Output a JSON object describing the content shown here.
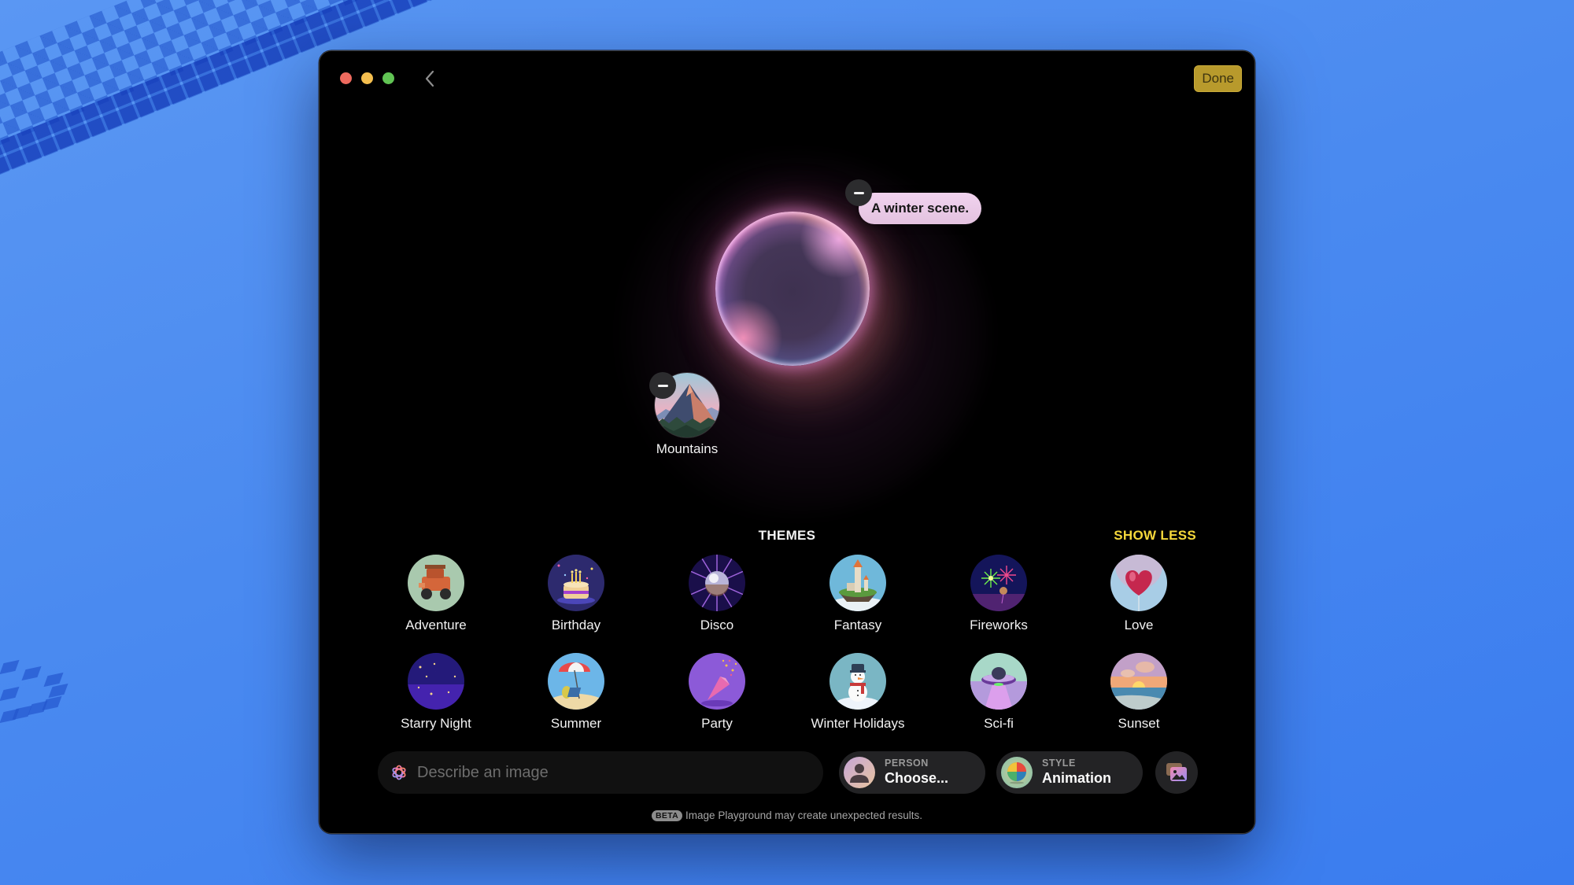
{
  "window": {
    "back_label": "Back",
    "done_label": "Done"
  },
  "canvas": {
    "prompt_chip": "A winter scene.",
    "concepts": [
      {
        "label": "Mountains",
        "icon": "mountain-icon"
      }
    ]
  },
  "themes": {
    "title": "THEMES",
    "toggle_label": "SHOW LESS",
    "items": [
      {
        "label": "Adventure",
        "icon": "jeep-icon"
      },
      {
        "label": "Birthday",
        "icon": "cake-icon"
      },
      {
        "label": "Disco",
        "icon": "disco-ball-icon"
      },
      {
        "label": "Fantasy",
        "icon": "castle-icon"
      },
      {
        "label": "Fireworks",
        "icon": "fireworks-icon"
      },
      {
        "label": "Love",
        "icon": "heart-balloon-icon"
      },
      {
        "label": "Starry Night",
        "icon": "moon-stars-icon"
      },
      {
        "label": "Summer",
        "icon": "beach-umbrella-icon"
      },
      {
        "label": "Party",
        "icon": "party-popper-icon"
      },
      {
        "label": "Winter Holidays",
        "icon": "snowman-icon"
      },
      {
        "label": "Sci-fi",
        "icon": "ufo-icon"
      },
      {
        "label": "Sunset",
        "icon": "sunset-icon"
      }
    ]
  },
  "bottom_bar": {
    "describe_placeholder": "Describe an image",
    "describe_value": "",
    "person": {
      "caption": "PERSON",
      "value": "Choose..."
    },
    "style": {
      "caption": "STYLE",
      "value": "Animation"
    },
    "gallery_icon": "photo-gallery-icon"
  },
  "footer": {
    "badge": "BETA",
    "notice": "Image Playground may create unexpected results."
  },
  "colors": {
    "accent_yellow": "#f5d83b",
    "done_button": "#b89a2c",
    "window_bg": "#000000",
    "wallpaper": "#4a8af0"
  }
}
